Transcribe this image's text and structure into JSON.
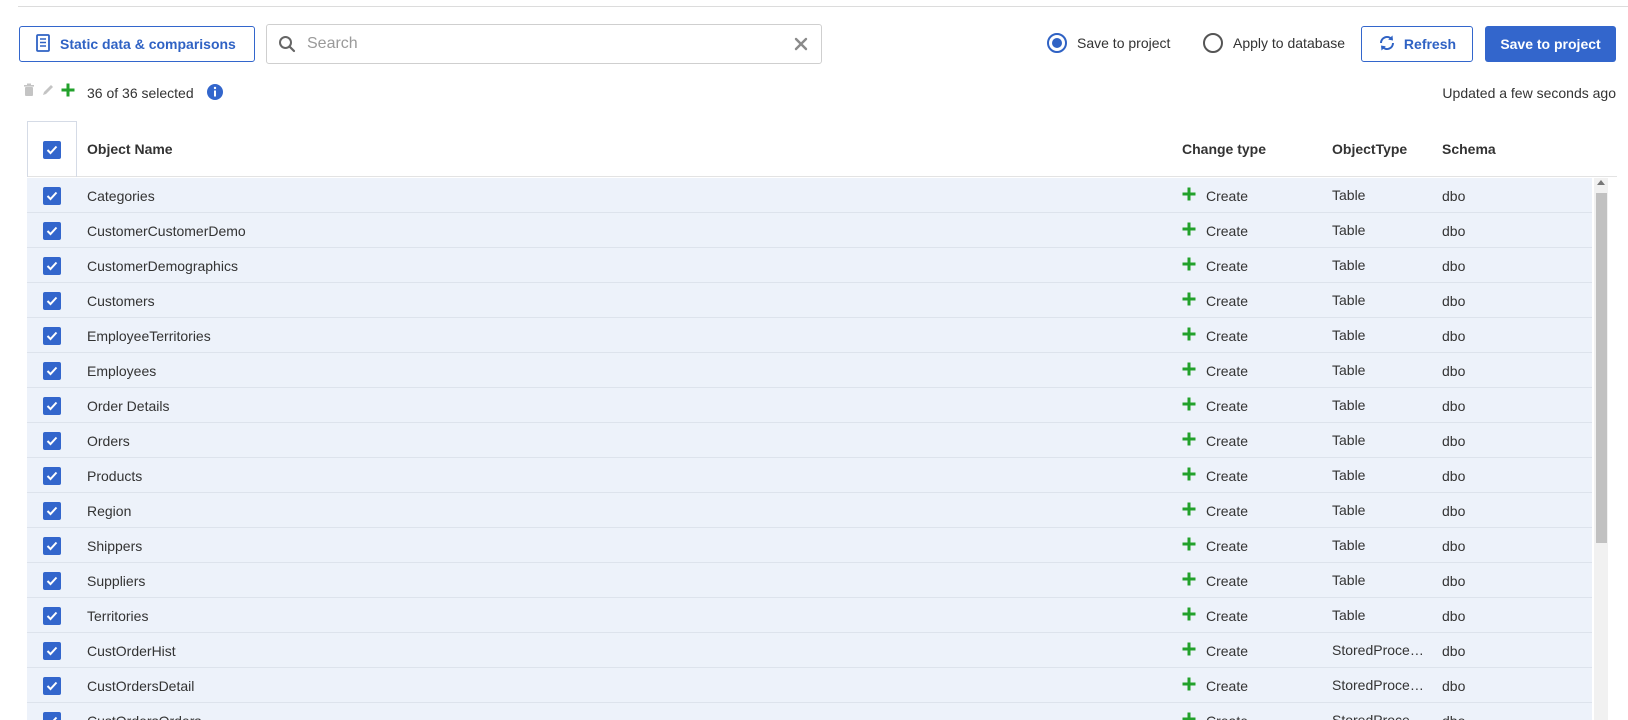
{
  "toolbar": {
    "static_label": "Static data & comparisons",
    "search_placeholder": "Search",
    "search_value": "",
    "radio_save": "Save to project",
    "radio_apply": "Apply to database",
    "selected_mode": "save",
    "refresh_label": "Refresh",
    "save_label": "Save to project"
  },
  "selection": {
    "count_text": "36 of 36 selected",
    "updated_text": "Updated a few seconds ago"
  },
  "colors": {
    "accent": "#3366cc",
    "create_green": "#22a12b",
    "row_bg": "#edf2fa"
  },
  "grid": {
    "columns": [
      "Object Name",
      "Change type",
      "ObjectType",
      "Schema"
    ],
    "rows": [
      {
        "name": "Categories",
        "change": "Create",
        "type": "Table",
        "schema": "dbo"
      },
      {
        "name": "CustomerCustomerDemo",
        "change": "Create",
        "type": "Table",
        "schema": "dbo"
      },
      {
        "name": "CustomerDemographics",
        "change": "Create",
        "type": "Table",
        "schema": "dbo"
      },
      {
        "name": "Customers",
        "change": "Create",
        "type": "Table",
        "schema": "dbo"
      },
      {
        "name": "EmployeeTerritories",
        "change": "Create",
        "type": "Table",
        "schema": "dbo"
      },
      {
        "name": "Employees",
        "change": "Create",
        "type": "Table",
        "schema": "dbo"
      },
      {
        "name": "Order Details",
        "change": "Create",
        "type": "Table",
        "schema": "dbo"
      },
      {
        "name": "Orders",
        "change": "Create",
        "type": "Table",
        "schema": "dbo"
      },
      {
        "name": "Products",
        "change": "Create",
        "type": "Table",
        "schema": "dbo"
      },
      {
        "name": "Region",
        "change": "Create",
        "type": "Table",
        "schema": "dbo"
      },
      {
        "name": "Shippers",
        "change": "Create",
        "type": "Table",
        "schema": "dbo"
      },
      {
        "name": "Suppliers",
        "change": "Create",
        "type": "Table",
        "schema": "dbo"
      },
      {
        "name": "Territories",
        "change": "Create",
        "type": "Table",
        "schema": "dbo"
      },
      {
        "name": "CustOrderHist",
        "change": "Create",
        "type": "StoredProce…",
        "schema": "dbo"
      },
      {
        "name": "CustOrdersDetail",
        "change": "Create",
        "type": "StoredProce…",
        "schema": "dbo"
      },
      {
        "name": "CustOrdersOrders",
        "change": "Create",
        "type": "StoredProce…",
        "schema": "dbo"
      }
    ]
  }
}
